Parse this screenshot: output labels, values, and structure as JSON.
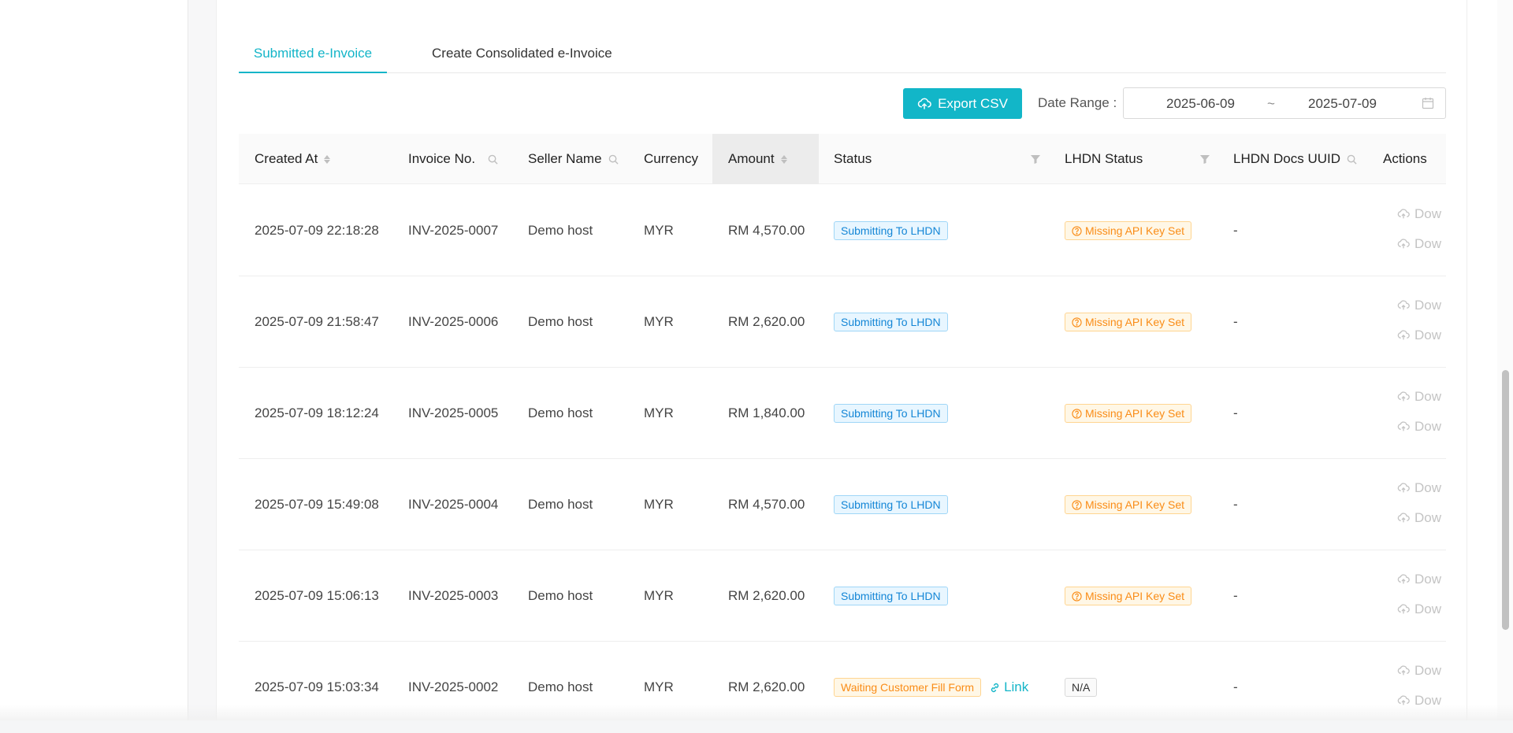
{
  "tabs": [
    {
      "label": "Submitted e-Invoice",
      "active": true
    },
    {
      "label": "Create Consolidated e-Invoice",
      "active": false
    }
  ],
  "toolbar": {
    "export_label": "Export CSV",
    "date_range_label": "Date Range :",
    "date_start": "2025-06-09",
    "date_separator": "~",
    "date_end": "2025-07-09"
  },
  "columns": {
    "created_at": "Created At",
    "invoice_no": "Invoice No.",
    "seller_name": "Seller Name",
    "currency": "Currency",
    "amount": "Amount",
    "status": "Status",
    "lhdn_status": "LHDN Status",
    "lhdn_docs_uuid": "LHDN Docs UUID",
    "actions": "Actions"
  },
  "rows": [
    {
      "created_at": "2025-07-09 22:18:28",
      "invoice_no": "INV-2025-0007",
      "seller_name": "Demo host",
      "currency": "MYR",
      "amount": "RM 4,570.00",
      "status": "Submitting To LHDN",
      "lhdn_status": "Missing API Key Set",
      "uuid": "-",
      "action1": "Dow",
      "action2": "Dow"
    },
    {
      "created_at": "2025-07-09 21:58:47",
      "invoice_no": "INV-2025-0006",
      "seller_name": "Demo host",
      "currency": "MYR",
      "amount": "RM 2,620.00",
      "status": "Submitting To LHDN",
      "lhdn_status": "Missing API Key Set",
      "uuid": "-",
      "action1": "Dow",
      "action2": "Dow"
    },
    {
      "created_at": "2025-07-09 18:12:24",
      "invoice_no": "INV-2025-0005",
      "seller_name": "Demo host",
      "currency": "MYR",
      "amount": "RM 1,840.00",
      "status": "Submitting To LHDN",
      "lhdn_status": "Missing API Key Set",
      "uuid": "-",
      "action1": "Dow",
      "action2": "Dow"
    },
    {
      "created_at": "2025-07-09 15:49:08",
      "invoice_no": "INV-2025-0004",
      "seller_name": "Demo host",
      "currency": "MYR",
      "amount": "RM 4,570.00",
      "status": "Submitting To LHDN",
      "lhdn_status": "Missing API Key Set",
      "uuid": "-",
      "action1": "Dow",
      "action2": "Dow"
    },
    {
      "created_at": "2025-07-09 15:06:13",
      "invoice_no": "INV-2025-0003",
      "seller_name": "Demo host",
      "currency": "MYR",
      "amount": "RM 2,620.00",
      "status": "Submitting To LHDN",
      "lhdn_status": "Missing API Key Set",
      "uuid": "-",
      "action1": "Dow",
      "action2": "Dow"
    },
    {
      "created_at": "2025-07-09 15:03:34",
      "invoice_no": "INV-2025-0002",
      "seller_name": "Demo host",
      "currency": "MYR",
      "amount": "RM 2,620.00",
      "status": "Waiting Customer Fill Form",
      "link": "Link",
      "lhdn_status": "N/A",
      "uuid": "-",
      "action1": "Dow",
      "action2": "Dow"
    }
  ],
  "colors": {
    "accent": "#13b5c8",
    "info": "#1486d6",
    "warning": "#fa8c16"
  }
}
